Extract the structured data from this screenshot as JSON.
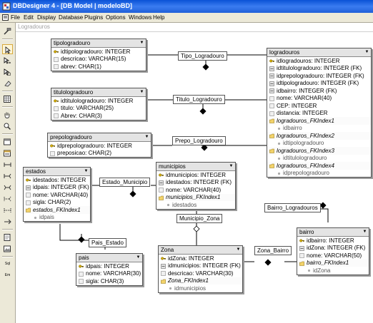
{
  "window": {
    "title": "DBDesigner 4 - [DB Model | modeloBD]"
  },
  "menu": [
    "File",
    "Edit",
    "Display",
    "Database",
    "Plugins",
    "Options",
    "Windows",
    "Help"
  ],
  "canvas": {
    "label": "Logradouros"
  },
  "toolbar": {
    "tools": [
      "pointer",
      "move",
      "select-area",
      "zoom-area",
      "grid",
      "snapshot",
      "pan",
      "zoom",
      "table",
      "view",
      "relation-1-1",
      "relation-1-n",
      "relation-n-m",
      "relation-1-n-sub",
      "relation-1-1-sub",
      "note",
      "image",
      "sqlcmd",
      "dict"
    ],
    "text_labels": {
      "sql": "Sql",
      "dict": "Em"
    }
  },
  "tables": {
    "tipologradouro": {
      "name": "tipologradouro",
      "rows": [
        {
          "type": "key",
          "text": "idtipologradouro: INTEGER"
        },
        {
          "type": "attr",
          "text": "descricao: VARCHAR(15)"
        },
        {
          "type": "attr",
          "text": "abrev: CHAR(1)"
        }
      ]
    },
    "titulologradouro": {
      "name": "titulologradouro",
      "rows": [
        {
          "type": "key",
          "text": "idtitulologradouro: INTEGER"
        },
        {
          "type": "attr",
          "text": "titulo: VARCHAR(25)"
        },
        {
          "type": "attr",
          "text": "Abrev: CHAR(3)"
        }
      ]
    },
    "prepologradouro": {
      "name": "prepologradouro",
      "rows": [
        {
          "type": "key",
          "text": "idprepologradouro: INTEGER"
        },
        {
          "type": "attr",
          "text": "preposicao: CHAR(2)"
        }
      ]
    },
    "logradouros": {
      "name": "logradouros",
      "rows": [
        {
          "type": "key",
          "text": "idlogradouros: INTEGER"
        },
        {
          "type": "fk",
          "text": "idtitulologradouro: INTEGER (FK)"
        },
        {
          "type": "fk",
          "text": "idprepologradouro: INTEGER (FK)"
        },
        {
          "type": "fk",
          "text": "idtipologradouro: INTEGER (FK)"
        },
        {
          "type": "fk",
          "text": "idbairro: INTEGER (FK)"
        },
        {
          "type": "attr",
          "text": "nome: VARCHAR(40)"
        },
        {
          "type": "attr",
          "text": "CEP: INTEGER"
        },
        {
          "type": "attr",
          "text": "distancia: INTEGER"
        },
        {
          "type": "idx",
          "text": "logradouros_FKIndex1"
        },
        {
          "type": "idxcol",
          "text": "idbairro"
        },
        {
          "type": "idx",
          "text": "logradouros_FKIndex2"
        },
        {
          "type": "idxcol",
          "text": "idtipologradouro"
        },
        {
          "type": "idx",
          "text": "logradouros_FKIndex3"
        },
        {
          "type": "idxcol",
          "text": "idtitulologradouro"
        },
        {
          "type": "idx",
          "text": "logradouros_FKIndex4"
        },
        {
          "type": "idxcol",
          "text": "idprepologradouro"
        }
      ]
    },
    "estados": {
      "name": "estados",
      "rows": [
        {
          "type": "key",
          "text": "idestados: INTEGER"
        },
        {
          "type": "fk",
          "text": "idpais: INTEGER (FK)"
        },
        {
          "type": "attr",
          "text": "nome: VARCHAR(40)"
        },
        {
          "type": "attr",
          "text": "sigla: CHAR(2)"
        },
        {
          "type": "idx",
          "text": "estados_FKIndex1"
        },
        {
          "type": "idxcol",
          "text": "idpais"
        }
      ]
    },
    "municipios": {
      "name": "municipios",
      "rows": [
        {
          "type": "key",
          "text": "idmunicipios: INTEGER"
        },
        {
          "type": "fk",
          "text": "idestados: INTEGER (FK)"
        },
        {
          "type": "attr",
          "text": "nome: VARCHAR(40)"
        },
        {
          "type": "idx",
          "text": "municipios_FKIndex1"
        },
        {
          "type": "idxcol",
          "text": "idestados"
        }
      ]
    },
    "pais": {
      "name": "pais",
      "rows": [
        {
          "type": "key",
          "text": "idpais: INTEGER"
        },
        {
          "type": "attr",
          "text": "nome: VARCHAR(30)"
        },
        {
          "type": "attr",
          "text": "sigla: CHAR(3)"
        }
      ]
    },
    "zona": {
      "name": "Zona",
      "rows": [
        {
          "type": "key",
          "text": "idZona: INTEGER"
        },
        {
          "type": "fk",
          "text": "idmunicipios: INTEGER (FK)"
        },
        {
          "type": "attr",
          "text": "descricao: VARCHAR(30)"
        },
        {
          "type": "idx",
          "text": "Zona_FKIndex1"
        },
        {
          "type": "idxcol",
          "text": "idmunicipios"
        }
      ]
    },
    "bairro": {
      "name": "bairro",
      "rows": [
        {
          "type": "key",
          "text": "idbairro: INTEGER"
        },
        {
          "type": "fk",
          "text": "idZona: INTEGER (FK)"
        },
        {
          "type": "attr",
          "text": "nome: VARCHAR(50)"
        },
        {
          "type": "idx",
          "text": "bairro_FKIndex1"
        },
        {
          "type": "idxcol",
          "text": "idZona"
        }
      ]
    }
  },
  "relations": {
    "tipo_logradouro": "Tipo_Logradouro",
    "titulo_logradouro": "Titulo_Logradouro",
    "prepo_logradouro": "Prepo_Logradouro",
    "estado_municipio": "Estado_Municipio",
    "municipio_zona": "Municipio_Zona",
    "pais_estado": "Pais_Estado",
    "zona_bairro": "Zona_Bairro",
    "bairro_logradouros": "Bairro_Logradouros"
  }
}
